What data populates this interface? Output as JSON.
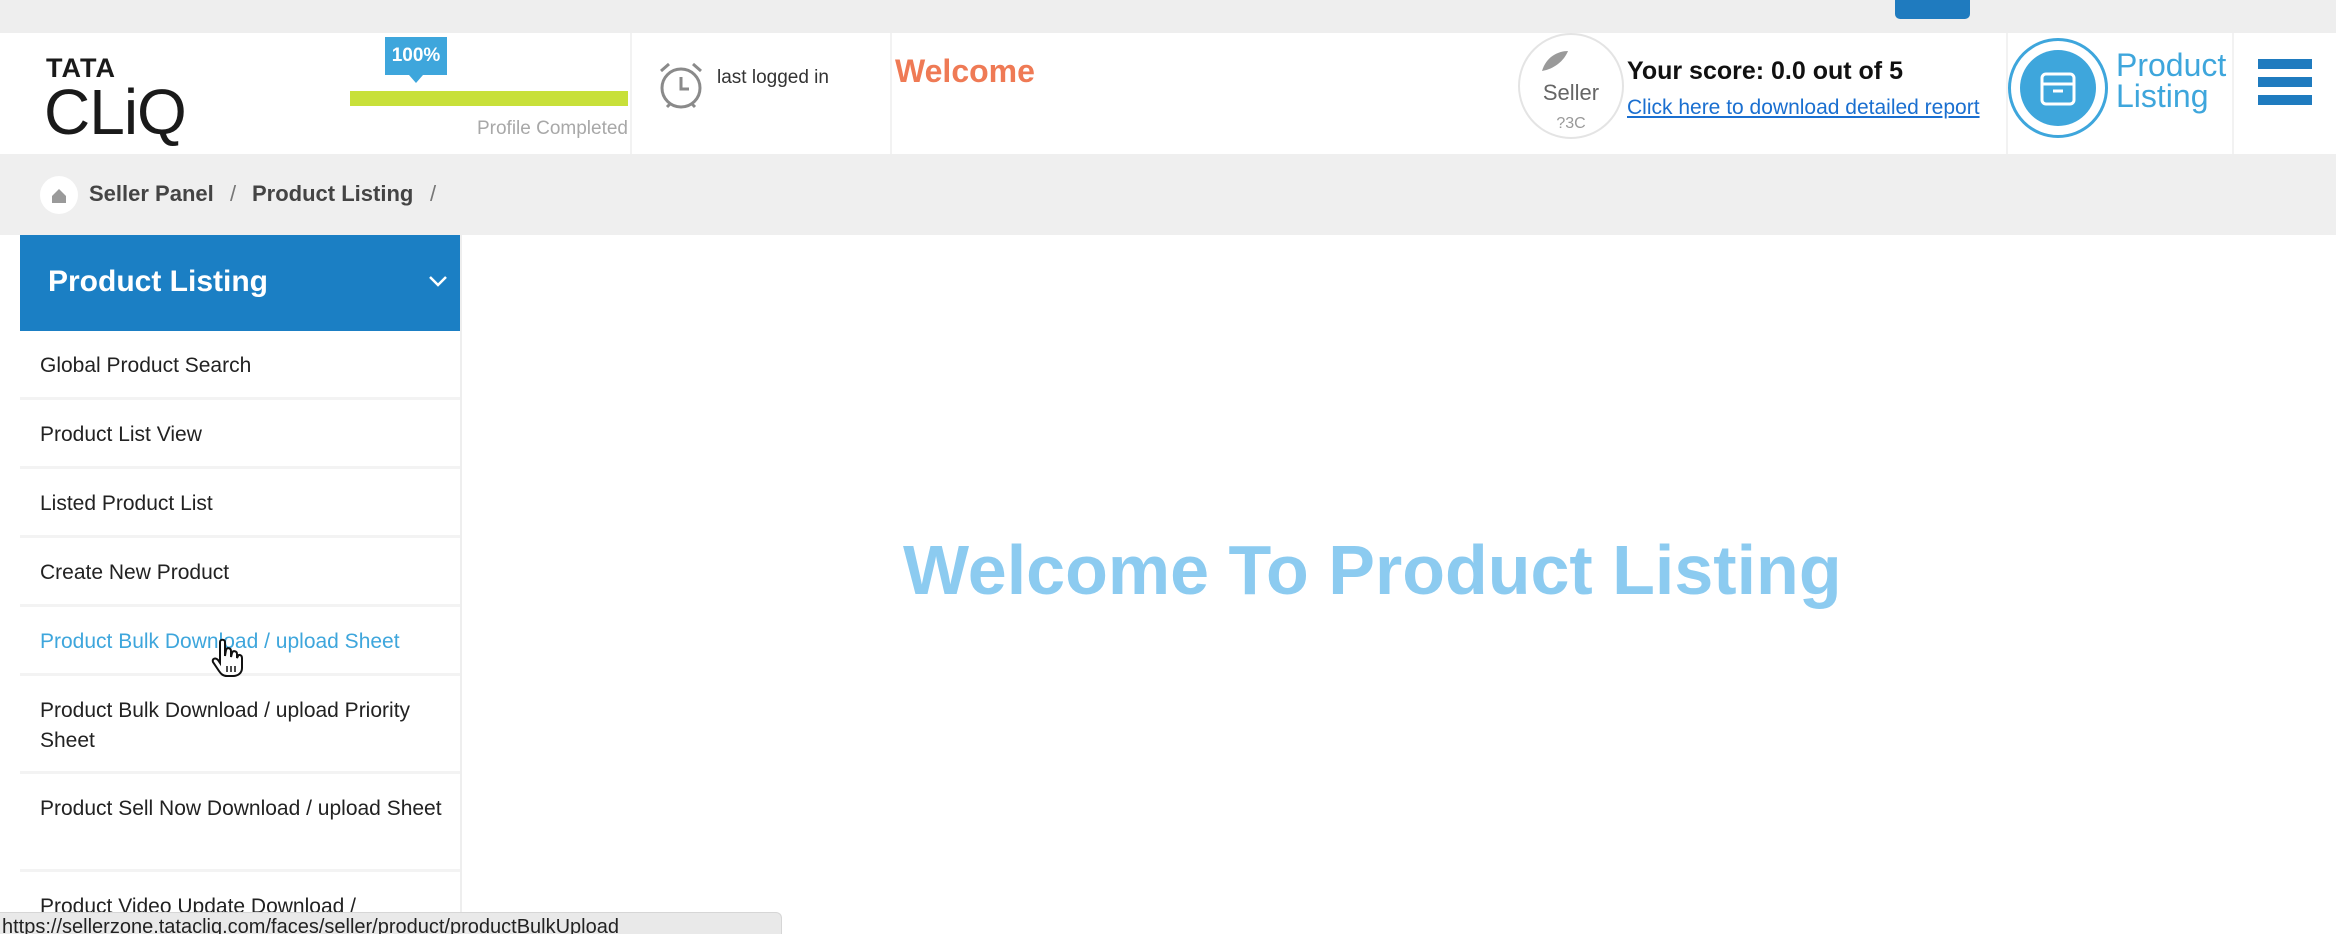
{
  "logo": {
    "line1": "TATA",
    "line2": "CLiQ"
  },
  "profile": {
    "percent_label": "100%",
    "progress": 1.0,
    "label": "Profile Completed"
  },
  "last_login": {
    "label": "last logged in"
  },
  "welcome_text": "Welcome",
  "seller": {
    "name": "Seller",
    "sub": "?3C"
  },
  "score": {
    "text": "Your score: 0.0 out of 5",
    "link": "Click here to download detailed report"
  },
  "module": {
    "line1": "Product",
    "line2": "Listing"
  },
  "breadcrumb": {
    "items": [
      "Seller Panel",
      "Product Listing"
    ],
    "separator": "/"
  },
  "sidebar": {
    "title": "Product Listing",
    "items": [
      {
        "label": "Global Product Search"
      },
      {
        "label": "Product List View"
      },
      {
        "label": "Listed Product List"
      },
      {
        "label": "Create New Product"
      },
      {
        "label": "Product Bulk Download / upload Sheet"
      },
      {
        "label": "Product Bulk Download / upload Priority Sheet"
      },
      {
        "label": "Product Sell Now Download / upload Sheet"
      },
      {
        "label": "Product Video Update Download /"
      }
    ]
  },
  "main": {
    "heading": "Welcome To Product Listing"
  },
  "status_url": "https://sellerzone.tatacliq.com/faces/seller/product/productBulkUpload",
  "colors": {
    "accent": "#1b7fc4",
    "light_accent": "#3ea6dc",
    "welcome": "#ef7a55",
    "progress": "#c8e03a"
  }
}
